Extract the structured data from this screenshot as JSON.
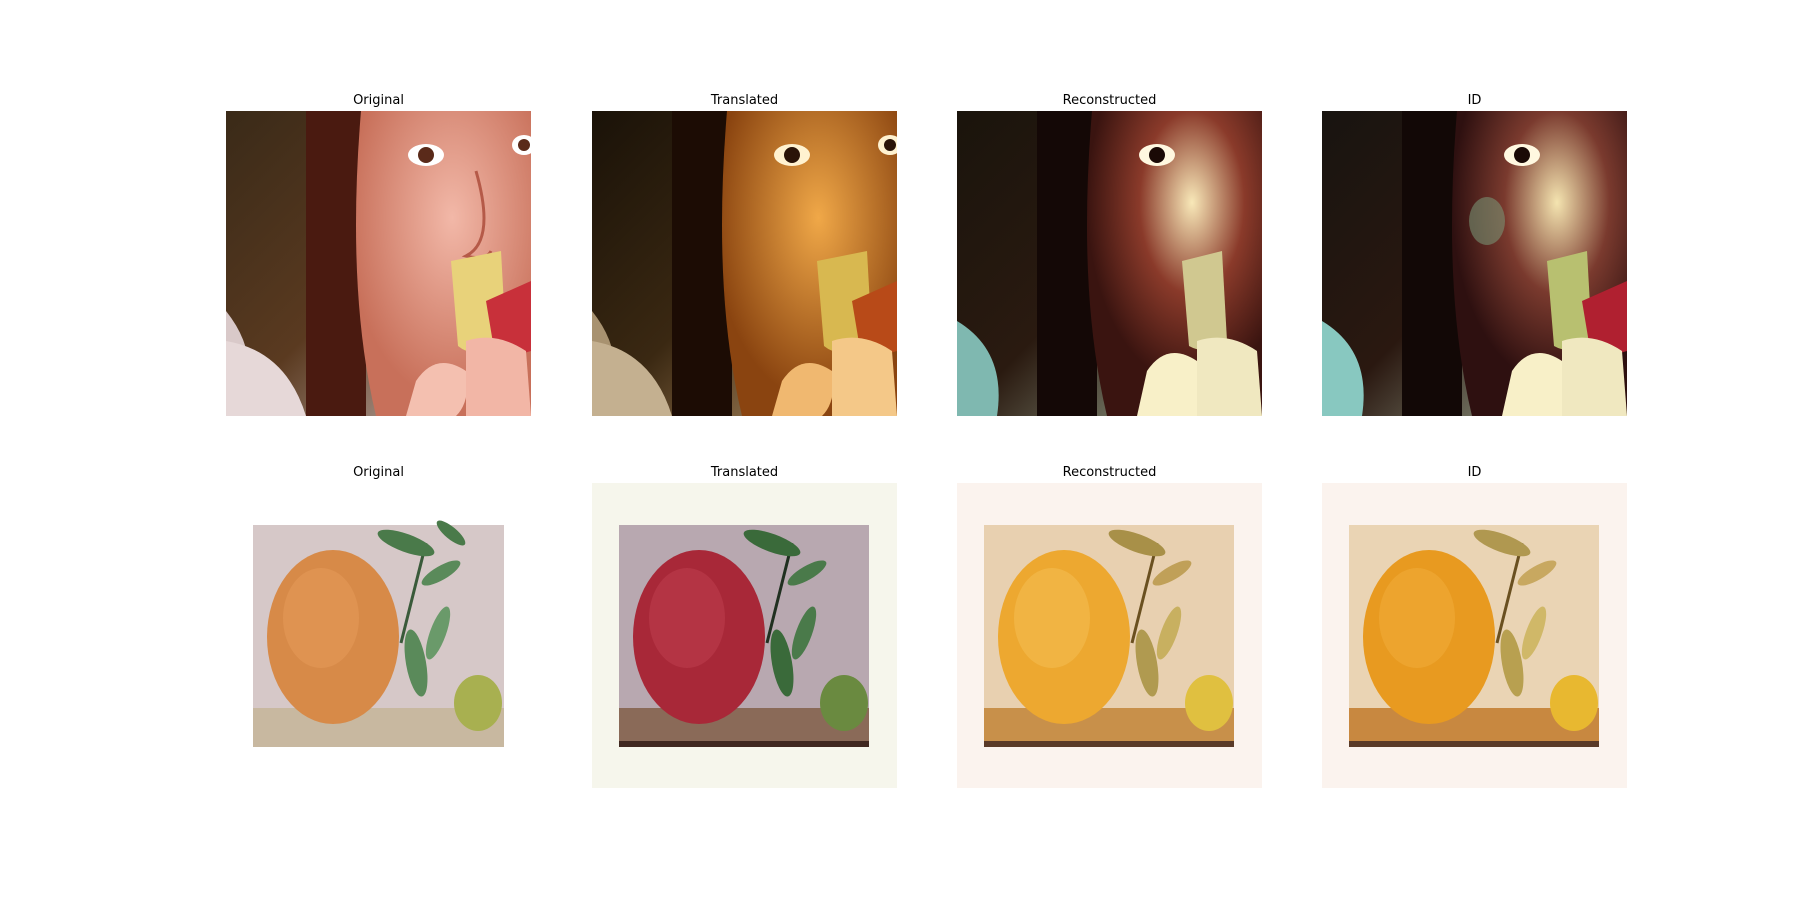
{
  "figure": {
    "rows": [
      {
        "panels": [
          {
            "title": "Original",
            "scene": "girl-eating-apple",
            "style": "original"
          },
          {
            "title": "Translated",
            "scene": "girl-eating-apple",
            "style": "translated"
          },
          {
            "title": "Reconstructed",
            "scene": "girl-eating-apple",
            "style": "reconstructed"
          },
          {
            "title": "ID",
            "scene": "girl-eating-apple",
            "style": "id"
          }
        ]
      },
      {
        "panels": [
          {
            "title": "Original",
            "scene": "orange-painting",
            "style": "original"
          },
          {
            "title": "Translated",
            "scene": "orange-painting",
            "style": "translated"
          },
          {
            "title": "Reconstructed",
            "scene": "orange-painting",
            "style": "reconstructed"
          },
          {
            "title": "ID",
            "scene": "orange-painting",
            "style": "id"
          }
        ]
      }
    ]
  },
  "colors": {
    "background": "#ffffff",
    "title_text": "#000000"
  }
}
